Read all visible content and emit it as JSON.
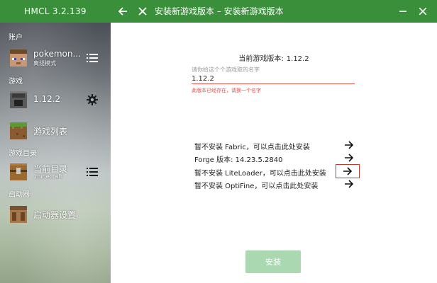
{
  "app": {
    "title": "HMCL 3.2.139"
  },
  "header": {
    "page_title": "安装新游戏版本 – 安装新游戏版本"
  },
  "sidebar": {
    "sections": {
      "account": "账户",
      "game": "游戏",
      "game_dir": "游戏目录",
      "launcher": "启动器"
    },
    "account_item": {
      "label": "pokemon...",
      "sublabel": "离线模式"
    },
    "game_item": {
      "label": "1.12.2"
    },
    "game_list_item": {
      "label": "游戏列表"
    },
    "dir_item": {
      "label": "当前目录",
      "sublabel": ".minecraft"
    },
    "settings_item": {
      "label": "启动器设置"
    }
  },
  "content": {
    "current_version_label": "当前游戏版本:",
    "current_version_value": "1.12.2",
    "name_field_label": "请你给这个个游戏取的名字",
    "name_value": "1.12.2",
    "name_error": "此版本已经存在，请换一个名字",
    "options": [
      {
        "text": "暂不安装 Fabric，可以点击此处安装"
      },
      {
        "text": "Forge 版本: 14.23.5.2840"
      },
      {
        "text": "暂不安装 LiteLoader，可以点击此处安装"
      },
      {
        "text": "暂不安装 OptiFine，可以点击此处安装"
      }
    ],
    "install_label": "安装"
  },
  "colors": {
    "accent": "#3a8f3a",
    "error": "#d9534f",
    "install_disabled": "#a9d8b1"
  }
}
